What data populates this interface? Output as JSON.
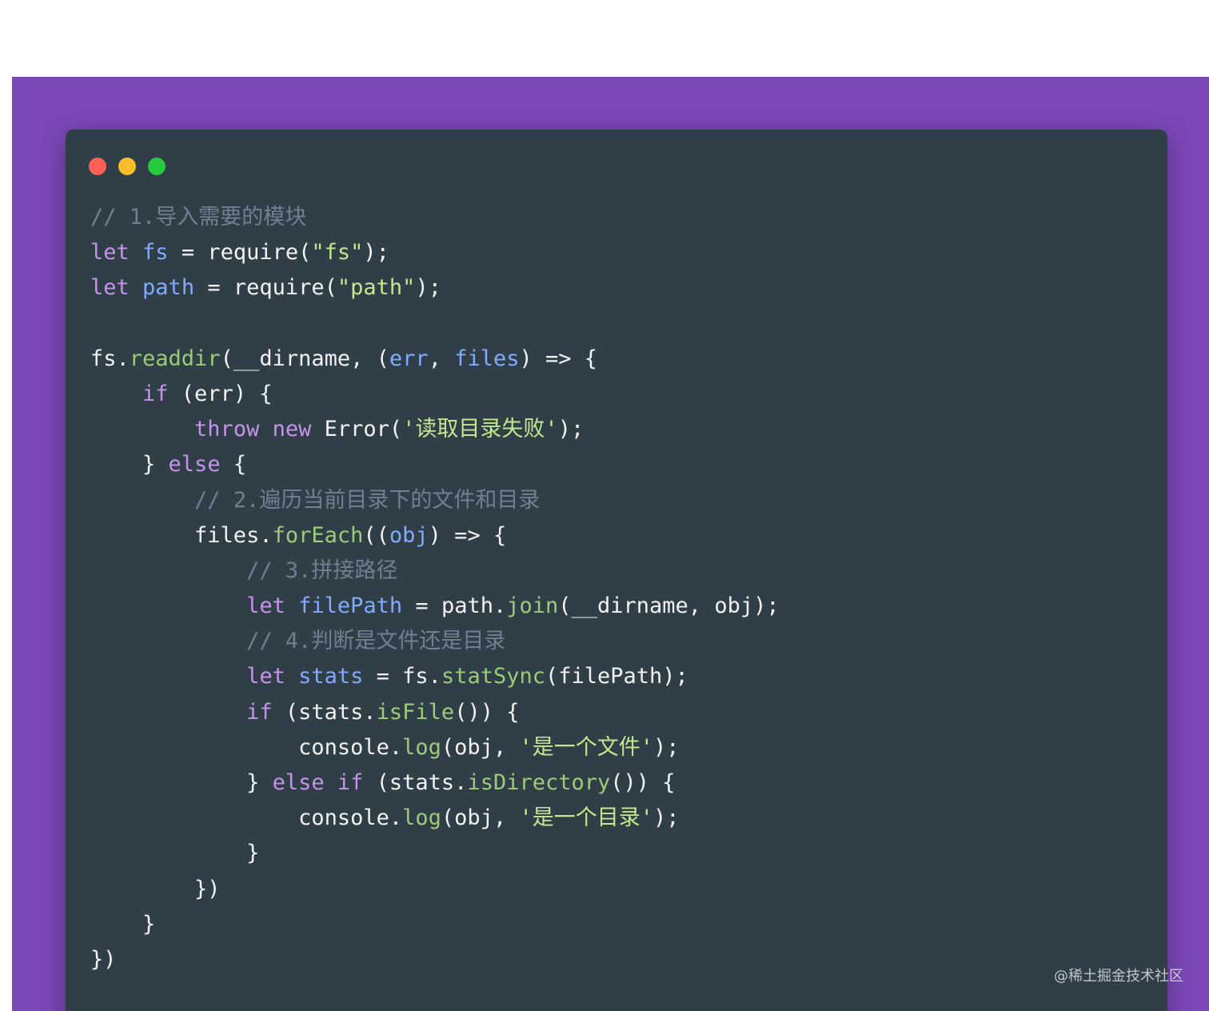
{
  "colors": {
    "page_background": "#ffffff",
    "frame_background": "#7b48b8",
    "window_background": "#2f3e47",
    "traffic_red": "#ff5f56",
    "traffic_yellow": "#ffbd2e",
    "traffic_green": "#27c93f"
  },
  "window": {
    "traffic_lights": [
      "close-dot",
      "minimize-dot",
      "maximize-dot"
    ]
  },
  "code": {
    "lines": [
      [
        {
          "t": "comment",
          "v": "// 1.导入需要的模块"
        }
      ],
      [
        {
          "t": "keyword",
          "v": "let"
        },
        {
          "t": "plain",
          "v": " "
        },
        {
          "t": "variable",
          "v": "fs"
        },
        {
          "t": "plain",
          "v": " = require("
        },
        {
          "t": "string",
          "v": "\"fs\""
        },
        {
          "t": "plain",
          "v": ");"
        }
      ],
      [
        {
          "t": "keyword",
          "v": "let"
        },
        {
          "t": "plain",
          "v": " "
        },
        {
          "t": "variable",
          "v": "path"
        },
        {
          "t": "plain",
          "v": " = require("
        },
        {
          "t": "string",
          "v": "\"path\""
        },
        {
          "t": "plain",
          "v": ");"
        }
      ],
      [],
      [
        {
          "t": "plain",
          "v": "fs."
        },
        {
          "t": "method",
          "v": "readdir"
        },
        {
          "t": "plain",
          "v": "(__dirname, ("
        },
        {
          "t": "variable",
          "v": "err"
        },
        {
          "t": "plain",
          "v": ", "
        },
        {
          "t": "variable",
          "v": "files"
        },
        {
          "t": "plain",
          "v": ") => {"
        }
      ],
      [
        {
          "t": "plain",
          "v": "    "
        },
        {
          "t": "keyword",
          "v": "if"
        },
        {
          "t": "plain",
          "v": " (err) {"
        }
      ],
      [
        {
          "t": "plain",
          "v": "        "
        },
        {
          "t": "keyword",
          "v": "throw"
        },
        {
          "t": "plain",
          "v": " "
        },
        {
          "t": "keyword",
          "v": "new"
        },
        {
          "t": "plain",
          "v": " Error("
        },
        {
          "t": "string",
          "v": "'读取目录失败'"
        },
        {
          "t": "plain",
          "v": ");"
        }
      ],
      [
        {
          "t": "plain",
          "v": "    } "
        },
        {
          "t": "keyword",
          "v": "else"
        },
        {
          "t": "plain",
          "v": " {"
        }
      ],
      [
        {
          "t": "plain",
          "v": "        "
        },
        {
          "t": "comment",
          "v": "// 2.遍历当前目录下的文件和目录"
        }
      ],
      [
        {
          "t": "plain",
          "v": "        files."
        },
        {
          "t": "method",
          "v": "forEach"
        },
        {
          "t": "plain",
          "v": "(("
        },
        {
          "t": "variable",
          "v": "obj"
        },
        {
          "t": "plain",
          "v": ") => {"
        }
      ],
      [
        {
          "t": "plain",
          "v": "            "
        },
        {
          "t": "comment",
          "v": "// 3.拼接路径"
        }
      ],
      [
        {
          "t": "plain",
          "v": "            "
        },
        {
          "t": "keyword",
          "v": "let"
        },
        {
          "t": "plain",
          "v": " "
        },
        {
          "t": "variable",
          "v": "filePath"
        },
        {
          "t": "plain",
          "v": " = path."
        },
        {
          "t": "method",
          "v": "join"
        },
        {
          "t": "plain",
          "v": "(__dirname, obj);"
        }
      ],
      [
        {
          "t": "plain",
          "v": "            "
        },
        {
          "t": "comment",
          "v": "// 4.判断是文件还是目录"
        }
      ],
      [
        {
          "t": "plain",
          "v": "            "
        },
        {
          "t": "keyword",
          "v": "let"
        },
        {
          "t": "plain",
          "v": " "
        },
        {
          "t": "variable",
          "v": "stats"
        },
        {
          "t": "plain",
          "v": " = fs."
        },
        {
          "t": "method",
          "v": "statSync"
        },
        {
          "t": "plain",
          "v": "(filePath);"
        }
      ],
      [
        {
          "t": "plain",
          "v": "            "
        },
        {
          "t": "keyword",
          "v": "if"
        },
        {
          "t": "plain",
          "v": " (stats."
        },
        {
          "t": "method",
          "v": "isFile"
        },
        {
          "t": "plain",
          "v": "()) {"
        }
      ],
      [
        {
          "t": "plain",
          "v": "                console."
        },
        {
          "t": "method",
          "v": "log"
        },
        {
          "t": "plain",
          "v": "(obj, "
        },
        {
          "t": "string",
          "v": "'是一个文件'"
        },
        {
          "t": "plain",
          "v": ");"
        }
      ],
      [
        {
          "t": "plain",
          "v": "            } "
        },
        {
          "t": "keyword",
          "v": "else"
        },
        {
          "t": "plain",
          "v": " "
        },
        {
          "t": "keyword",
          "v": "if"
        },
        {
          "t": "plain",
          "v": " (stats."
        },
        {
          "t": "method",
          "v": "isDirectory"
        },
        {
          "t": "plain",
          "v": "()) {"
        }
      ],
      [
        {
          "t": "plain",
          "v": "                console."
        },
        {
          "t": "method",
          "v": "log"
        },
        {
          "t": "plain",
          "v": "(obj, "
        },
        {
          "t": "string",
          "v": "'是一个目录'"
        },
        {
          "t": "plain",
          "v": ");"
        }
      ],
      [
        {
          "t": "plain",
          "v": "            }"
        }
      ],
      [
        {
          "t": "plain",
          "v": "        })"
        }
      ],
      [
        {
          "t": "plain",
          "v": "    }"
        }
      ],
      [
        {
          "t": "plain",
          "v": "})"
        }
      ]
    ]
  },
  "watermark": "@稀土掘金技术社区"
}
